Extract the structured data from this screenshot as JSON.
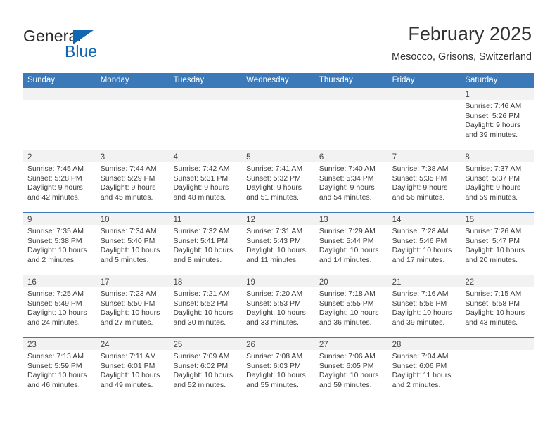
{
  "brand": {
    "name_top": "General",
    "name_bottom": "Blue",
    "triangle_color": "#1267b2",
    "text_color": "#2b2b2b"
  },
  "header": {
    "title": "February 2025",
    "subtitle": "Mesocco, Grisons, Switzerland"
  },
  "calendar": {
    "header_bg": "#3b79b8",
    "header_text": "#ffffff",
    "daynum_band_bg": "#f2f2f2",
    "weekdays": [
      "Sunday",
      "Monday",
      "Tuesday",
      "Wednesday",
      "Thursday",
      "Friday",
      "Saturday"
    ],
    "weeks": [
      [
        {
          "day": "",
          "lines": []
        },
        {
          "day": "",
          "lines": []
        },
        {
          "day": "",
          "lines": []
        },
        {
          "day": "",
          "lines": []
        },
        {
          "day": "",
          "lines": []
        },
        {
          "day": "",
          "lines": []
        },
        {
          "day": "1",
          "lines": [
            "Sunrise: 7:46 AM",
            "Sunset: 5:26 PM",
            "Daylight: 9 hours",
            "and 39 minutes."
          ]
        }
      ],
      [
        {
          "day": "2",
          "lines": [
            "Sunrise: 7:45 AM",
            "Sunset: 5:28 PM",
            "Daylight: 9 hours",
            "and 42 minutes."
          ]
        },
        {
          "day": "3",
          "lines": [
            "Sunrise: 7:44 AM",
            "Sunset: 5:29 PM",
            "Daylight: 9 hours",
            "and 45 minutes."
          ]
        },
        {
          "day": "4",
          "lines": [
            "Sunrise: 7:42 AM",
            "Sunset: 5:31 PM",
            "Daylight: 9 hours",
            "and 48 minutes."
          ]
        },
        {
          "day": "5",
          "lines": [
            "Sunrise: 7:41 AM",
            "Sunset: 5:32 PM",
            "Daylight: 9 hours",
            "and 51 minutes."
          ]
        },
        {
          "day": "6",
          "lines": [
            "Sunrise: 7:40 AM",
            "Sunset: 5:34 PM",
            "Daylight: 9 hours",
            "and 54 minutes."
          ]
        },
        {
          "day": "7",
          "lines": [
            "Sunrise: 7:38 AM",
            "Sunset: 5:35 PM",
            "Daylight: 9 hours",
            "and 56 minutes."
          ]
        },
        {
          "day": "8",
          "lines": [
            "Sunrise: 7:37 AM",
            "Sunset: 5:37 PM",
            "Daylight: 9 hours",
            "and 59 minutes."
          ]
        }
      ],
      [
        {
          "day": "9",
          "lines": [
            "Sunrise: 7:35 AM",
            "Sunset: 5:38 PM",
            "Daylight: 10 hours",
            "and 2 minutes."
          ]
        },
        {
          "day": "10",
          "lines": [
            "Sunrise: 7:34 AM",
            "Sunset: 5:40 PM",
            "Daylight: 10 hours",
            "and 5 minutes."
          ]
        },
        {
          "day": "11",
          "lines": [
            "Sunrise: 7:32 AM",
            "Sunset: 5:41 PM",
            "Daylight: 10 hours",
            "and 8 minutes."
          ]
        },
        {
          "day": "12",
          "lines": [
            "Sunrise: 7:31 AM",
            "Sunset: 5:43 PM",
            "Daylight: 10 hours",
            "and 11 minutes."
          ]
        },
        {
          "day": "13",
          "lines": [
            "Sunrise: 7:29 AM",
            "Sunset: 5:44 PM",
            "Daylight: 10 hours",
            "and 14 minutes."
          ]
        },
        {
          "day": "14",
          "lines": [
            "Sunrise: 7:28 AM",
            "Sunset: 5:46 PM",
            "Daylight: 10 hours",
            "and 17 minutes."
          ]
        },
        {
          "day": "15",
          "lines": [
            "Sunrise: 7:26 AM",
            "Sunset: 5:47 PM",
            "Daylight: 10 hours",
            "and 20 minutes."
          ]
        }
      ],
      [
        {
          "day": "16",
          "lines": [
            "Sunrise: 7:25 AM",
            "Sunset: 5:49 PM",
            "Daylight: 10 hours",
            "and 24 minutes."
          ]
        },
        {
          "day": "17",
          "lines": [
            "Sunrise: 7:23 AM",
            "Sunset: 5:50 PM",
            "Daylight: 10 hours",
            "and 27 minutes."
          ]
        },
        {
          "day": "18",
          "lines": [
            "Sunrise: 7:21 AM",
            "Sunset: 5:52 PM",
            "Daylight: 10 hours",
            "and 30 minutes."
          ]
        },
        {
          "day": "19",
          "lines": [
            "Sunrise: 7:20 AM",
            "Sunset: 5:53 PM",
            "Daylight: 10 hours",
            "and 33 minutes."
          ]
        },
        {
          "day": "20",
          "lines": [
            "Sunrise: 7:18 AM",
            "Sunset: 5:55 PM",
            "Daylight: 10 hours",
            "and 36 minutes."
          ]
        },
        {
          "day": "21",
          "lines": [
            "Sunrise: 7:16 AM",
            "Sunset: 5:56 PM",
            "Daylight: 10 hours",
            "and 39 minutes."
          ]
        },
        {
          "day": "22",
          "lines": [
            "Sunrise: 7:15 AM",
            "Sunset: 5:58 PM",
            "Daylight: 10 hours",
            "and 43 minutes."
          ]
        }
      ],
      [
        {
          "day": "23",
          "lines": [
            "Sunrise: 7:13 AM",
            "Sunset: 5:59 PM",
            "Daylight: 10 hours",
            "and 46 minutes."
          ]
        },
        {
          "day": "24",
          "lines": [
            "Sunrise: 7:11 AM",
            "Sunset: 6:01 PM",
            "Daylight: 10 hours",
            "and 49 minutes."
          ]
        },
        {
          "day": "25",
          "lines": [
            "Sunrise: 7:09 AM",
            "Sunset: 6:02 PM",
            "Daylight: 10 hours",
            "and 52 minutes."
          ]
        },
        {
          "day": "26",
          "lines": [
            "Sunrise: 7:08 AM",
            "Sunset: 6:03 PM",
            "Daylight: 10 hours",
            "and 55 minutes."
          ]
        },
        {
          "day": "27",
          "lines": [
            "Sunrise: 7:06 AM",
            "Sunset: 6:05 PM",
            "Daylight: 10 hours",
            "and 59 minutes."
          ]
        },
        {
          "day": "28",
          "lines": [
            "Sunrise: 7:04 AM",
            "Sunset: 6:06 PM",
            "Daylight: 11 hours",
            "and 2 minutes."
          ]
        },
        {
          "day": "",
          "lines": []
        }
      ]
    ]
  }
}
